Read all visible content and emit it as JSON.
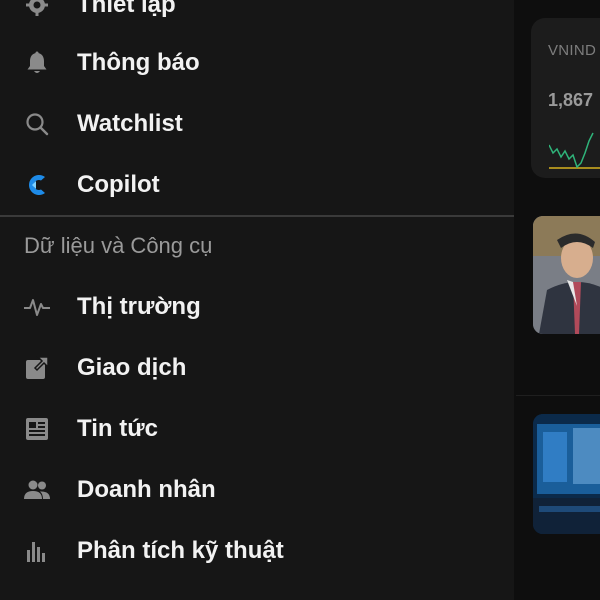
{
  "drawer": {
    "items_top": [
      {
        "id": "settings",
        "label": "Thiết lập",
        "icon": "gear-icon"
      },
      {
        "id": "notifications",
        "label": "Thông báo",
        "icon": "bell-icon"
      },
      {
        "id": "watchlist",
        "label": "Watchlist",
        "icon": "search-icon"
      },
      {
        "id": "copilot",
        "label": "Copilot",
        "icon": "copilot-logo-icon"
      }
    ],
    "section_title": "Dữ liệu và Công cụ",
    "items_tools": [
      {
        "id": "market",
        "label": "Thị trường",
        "icon": "pulse-icon"
      },
      {
        "id": "trading",
        "label": "Giao dịch",
        "icon": "external-link-icon"
      },
      {
        "id": "news",
        "label": "Tin tức",
        "icon": "newspaper-icon"
      },
      {
        "id": "entrepreneurs",
        "label": "Doanh nhân",
        "icon": "people-icon"
      },
      {
        "id": "technical",
        "label": "Phân tích kỹ thuật",
        "icon": "bar-chart-icon"
      }
    ]
  },
  "background": {
    "index_name": "VNIND",
    "index_value": "1,867",
    "accent_up": "#2fb47a",
    "accent_ref": "#d6b21e"
  },
  "colors": {
    "drawer_bg": "#161616",
    "text_primary": "#f2f2f2",
    "text_secondary": "#9a9a9a",
    "copilot_blue": "#1e8be8"
  }
}
